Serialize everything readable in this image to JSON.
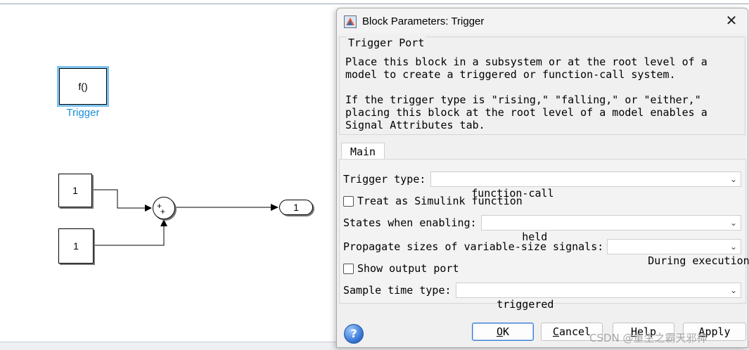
{
  "canvas": {
    "trigger_block": {
      "text": "f()",
      "label": "Trigger"
    },
    "constant_1": "1",
    "constant_2": "1",
    "sum_signs": {
      "top": "+",
      "bottom": "+"
    },
    "outport": "1"
  },
  "dialog": {
    "title": "Block Parameters: Trigger",
    "close_glyph": "✕",
    "group_title": "Trigger Port",
    "description": [
      "Place this block in a subsystem or at the root level of a",
      "model to create a triggered or function-call system.",
      "If the trigger type is \"rising,\" \"falling,\" or \"either,\"",
      "placing this block at the root level of a model enables a",
      "Signal Attributes tab."
    ],
    "tab_main": "Main",
    "params": {
      "trigger_type": {
        "label": "Trigger type:",
        "value": "function-call"
      },
      "treat_as_simulink_function": {
        "label": "Treat as Simulink function",
        "checked": false
      },
      "states_when_enabling": {
        "label": "States when enabling:",
        "value": "held"
      },
      "propagate_sizes": {
        "label": "Propagate sizes of variable-size signals:",
        "value": "During execution"
      },
      "show_output_port": {
        "label": "Show output port",
        "checked": false
      },
      "sample_time_type": {
        "label": "Sample time type:",
        "value": "triggered"
      }
    },
    "buttons": {
      "ok": {
        "first": "O",
        "rest": "K"
      },
      "cancel": {
        "first": "C",
        "rest": "ancel"
      },
      "help": {
        "first": "H",
        "rest": "elp"
      },
      "apply": {
        "first": "A",
        "rest": "pply"
      }
    },
    "help_icon": "?"
  },
  "watermark": "CSDN @重生之霸天邪神",
  "icons": [
    "simulink-app-icon",
    "close-icon",
    "chevron-down-icon",
    "help-icon"
  ]
}
